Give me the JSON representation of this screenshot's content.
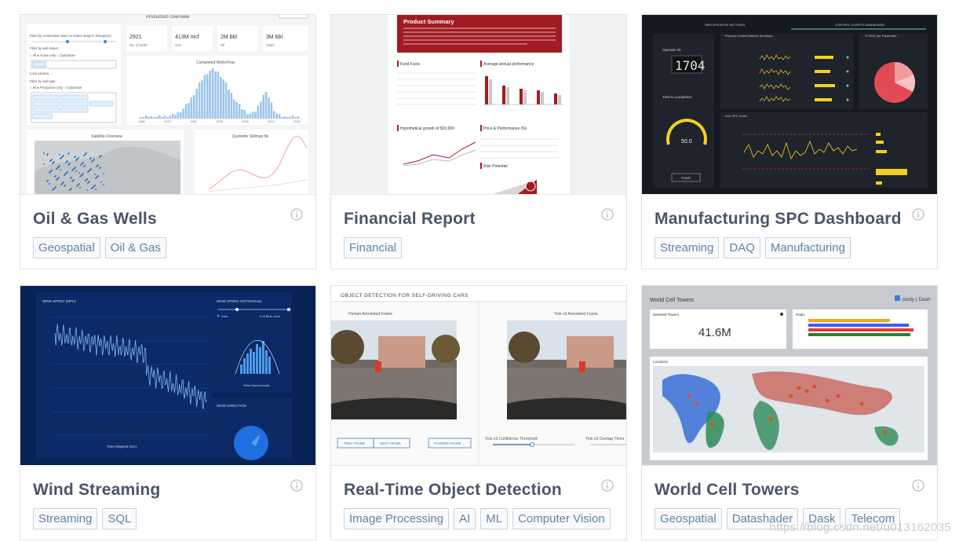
{
  "cards": [
    {
      "title": "Oil & Gas Wells",
      "tags": [
        "Geospatial",
        "Oil & Gas"
      ],
      "preview": {
        "header": "Production Overview",
        "stats": [
          {
            "value": "2921",
            "label": "No. of Wells"
          },
          {
            "value": "413M mcf",
            "label": "Gas"
          },
          {
            "value": "2M bbl",
            "label": "Oil"
          },
          {
            "value": "3M bbl",
            "label": "Water"
          }
        ],
        "chart_title": "Completed Wells/Year",
        "filter_date_label": "Filter by construction date (or select range in histogram):",
        "filter_status_label": "Filter by well status:",
        "filter_type_label": "Filter by well type:",
        "lock_camera": "Lock camera",
        "map_title": "Satellite Overview",
        "side_chart_title": "Quintette Stillman 8e",
        "years": [
          "1960",
          "1970",
          "1980",
          "1990",
          "2000",
          "2010",
          "2020"
        ]
      }
    },
    {
      "title": "Financial Report",
      "tags": [
        "Financial"
      ],
      "preview": {
        "header": "Product Summary",
        "fund_facts": "Fund Facts",
        "avg_perf": "Average annual performance",
        "growth": "Hypothetical growth of $10,000",
        "price_perf": "Price & Performance (%)",
        "risk": "Risk Potential"
      }
    },
    {
      "title": "Manufacturing SPC Dashboard",
      "tags": [
        "Streaming",
        "DAQ",
        "Manufacturing"
      ],
      "preview": {
        "tab1": "SPECIFICATION SETTINGS",
        "tab2": "CONTROL CHARTS DASHBOARD",
        "operator_label": "Operator ID",
        "operator_value": "1704",
        "time_label": "Time to completion",
        "gauge_value": "50.0",
        "start": "START",
        "metrics_title": "Process Control Metrics Summary",
        "ooc_title": "% OOC per Parameter",
        "spc_title": "Live SPC Chart"
      }
    },
    {
      "title": "Wind Streaming",
      "tags": [
        "Streaming",
        "SQL"
      ],
      "preview": {
        "speed_title": "WIND SPEED (MPH)",
        "hist_title": "WIND SPEED HISTOGRAM",
        "dir_title": "WIND DIRECTION",
        "x_label": "Time Elapsed (sec)",
        "hist_x": "Wind Speed (mph)",
        "auto": "Auto",
        "bins": "# of Bins: Auto"
      }
    },
    {
      "title": "Real-Time Object Detection",
      "tags": [
        "Image Processing",
        "AI",
        "ML",
        "Computer Vision"
      ],
      "preview": {
        "header": "OBJECT DETECTION FOR SELF-DRIVING CARS",
        "left_frame": "Human Annotated Frame",
        "right_frame": "Yolo v3 Annotated Frame",
        "prev": "PREV FRAME",
        "next": "NEXT FRAME",
        "random": "RANDOM FRAME",
        "threshold": "Yolo v3 Confidence Threshold:",
        "overlap": "Yolo v3 Overlap Thres"
      }
    },
    {
      "title": "World Cell Towers",
      "tags": [
        "Geospatial",
        "Datashader",
        "Dask",
        "Telecom"
      ],
      "preview": {
        "header": "World Cell Towers",
        "brand": "plotly | Dash",
        "selected_label": "Selected Towers",
        "selected_value": "41.6M",
        "radio_label": "Radio",
        "locations_label": "Locations"
      }
    }
  ],
  "watermark": "https://blog.csdn.net/u013162035"
}
